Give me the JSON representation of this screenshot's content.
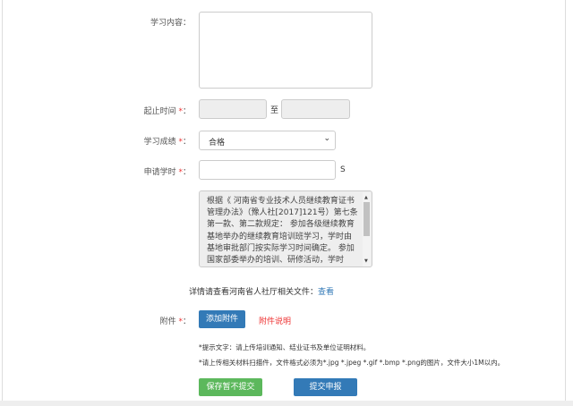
{
  "labels": {
    "content": "学习内容：",
    "period": "起止时间",
    "grade": "学习成绩",
    "hours": "申请学时",
    "attach": "附件",
    "req_mark": "*",
    "colon": "："
  },
  "period": {
    "separator": "至",
    "start": "",
    "end": ""
  },
  "grade": {
    "selected": "合格"
  },
  "hours": {
    "value": "",
    "unit": "S"
  },
  "notice": "根据《 河南省专业技术人员继续教育证书管理办法》（豫人社[2017]121号）第七条第一款、第二款规定： 参加各级继续教育基地举办的继续教育培训班学习，学时由基地审批部门按实际学习时间确定。 参加国家部委举办的培训、研修活动，学时",
  "details": {
    "text": "详情请查看河南省人社厅相关文件：",
    "link": "查看"
  },
  "attach": {
    "add_button": "添加附件",
    "explain_link": "附件说明"
  },
  "hints": [
    "*提示文字：请上传培训通知、结业证书及单位证明材料。",
    "*请上传相关材料扫描件，文件格式必须为*.jpg *.jpeg *.gif *.bmp *.png的图片，文件大小1M以内。"
  ],
  "buttons": {
    "save": "保存暂不提交",
    "submit": "提交申报"
  },
  "colors": {
    "primary": "#337ab7",
    "success": "#5cb85c",
    "danger": "#e33"
  }
}
